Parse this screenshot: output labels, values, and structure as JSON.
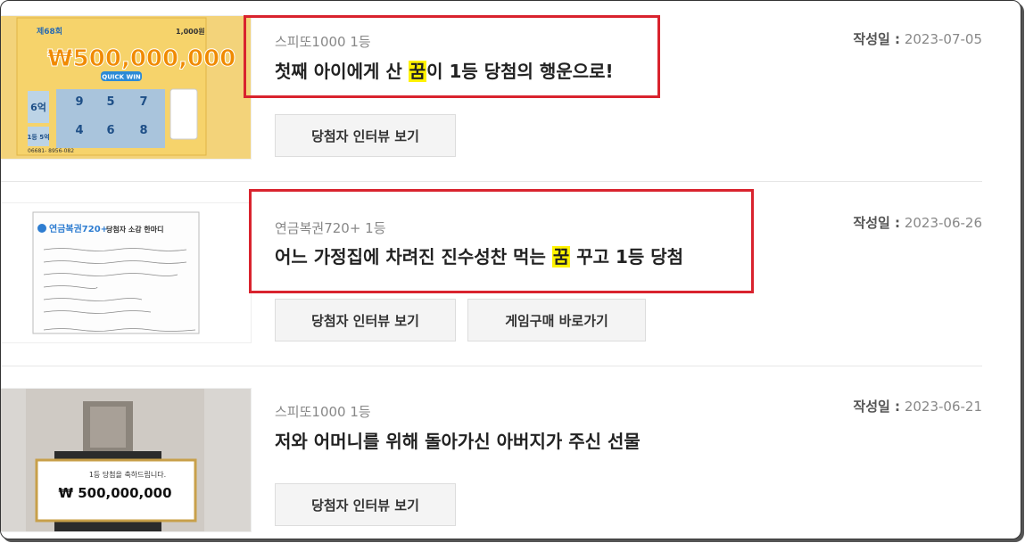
{
  "posts": [
    {
      "category": "스피또1000 1등",
      "title_before": "첫째 아이에게 산 ",
      "title_highlight": "꿈",
      "title_after": "이 1등 당첨의 행운으로!",
      "date_label": "작성일 :",
      "date": "2023-07-05",
      "buttons": [
        "당첨자 인터뷰 보기"
      ],
      "thumb": {
        "round": "제68회",
        "price": "1,000원",
        "amount": "₩500,000,000",
        "quick": "QUICK WIN",
        "cells": [
          "6억",
          "9",
          "5",
          "7",
          "4",
          "6",
          "8"
        ],
        "first": "1등 5억",
        "barcode": "06681- 8956-082"
      }
    },
    {
      "category": "연금복권720+ 1등",
      "title_before": "어느 가정집에 차려진 진수성찬 먹는 ",
      "title_highlight": "꿈",
      "title_after": " 꾸고 1등 당첨",
      "date_label": "작성일 :",
      "date": "2023-06-26",
      "buttons": [
        "당첨자 인터뷰 보기",
        "게임구매 바로가기"
      ],
      "thumb": {
        "logo": "연금복권720+",
        "heading": "당첨자 소감 한마디"
      }
    },
    {
      "category": "스피또1000 1등",
      "title_before": "저와 어머니를 위해 돌아가신 아버지가 주신 선물",
      "title_highlight": "",
      "title_after": "",
      "date_label": "작성일 :",
      "date": "2023-06-21",
      "buttons": [
        "당첨자 인터뷰 보기"
      ],
      "thumb": {
        "board_text": "1등 당첨을 축하드립니다.",
        "amount": "₩ 500,000,000"
      }
    }
  ],
  "colors": {
    "highlight": "#fff200",
    "annotation": "#d9232e"
  }
}
